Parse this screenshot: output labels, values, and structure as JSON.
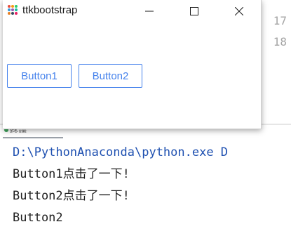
{
  "window": {
    "title": "ttkbootstrap",
    "controls": {
      "minimize": "—",
      "maximize": "☐",
      "close": "✕"
    },
    "icon": "ttkbootstrap-logo-icon"
  },
  "buttons": [
    {
      "label": "Button1"
    },
    {
      "label": "Button2"
    }
  ],
  "ide": {
    "line_numbers": [
      "17",
      "18"
    ],
    "panel_tab_label": "终端"
  },
  "console": {
    "lines": [
      "D:\\PythonAnaconda\\python.exe D",
      "Button1点击了一下!",
      "Button2点击了一下!",
      "Button2"
    ]
  },
  "colors": {
    "accent": "#4582ec",
    "console_path": "#1d4fb0",
    "console_text": "#1f1f1f"
  }
}
